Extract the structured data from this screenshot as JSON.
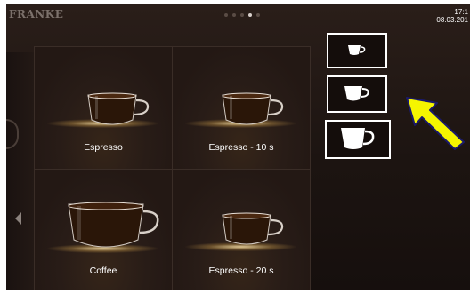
{
  "brand": {
    "name": "FRANKE"
  },
  "pager": {
    "count": 5,
    "active_index": 3
  },
  "clock": {
    "time": "17:1",
    "date": "08.03.201"
  },
  "colors": {
    "accent_arrow": "#f5f500",
    "glow": "#ffe6aa",
    "background": "#1e1512"
  },
  "beverages": [
    {
      "label": "Espresso",
      "icon": "espresso-cup-icon"
    },
    {
      "label": "Espresso - 10 s",
      "icon": "espresso-cup-icon"
    },
    {
      "label": "Coffee",
      "icon": "coffee-cup-icon"
    },
    {
      "label": "Espresso - 20 s",
      "icon": "espresso-cup-icon"
    }
  ],
  "cup_sizes": [
    {
      "size": "small",
      "icon": "small-cup-icon",
      "selected": false
    },
    {
      "size": "medium",
      "icon": "medium-cup-icon",
      "selected": true
    },
    {
      "size": "large",
      "icon": "large-cup-icon",
      "selected": false
    }
  ],
  "navigation": {
    "previous_icon": "chevron-left-icon"
  },
  "annotation": {
    "icon": "pointer-arrow-icon"
  }
}
